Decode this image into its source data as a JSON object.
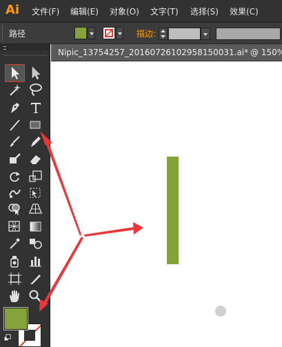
{
  "app": {
    "logo_text": "Ai"
  },
  "menu": {
    "items": [
      {
        "label": "文件(F)"
      },
      {
        "label": "编辑(E)"
      },
      {
        "label": "对象(O)"
      },
      {
        "label": "文字(T)"
      },
      {
        "label": "选择(S)"
      },
      {
        "label": "效果(C)"
      }
    ]
  },
  "control_bar": {
    "selection_type": "路径",
    "fill_color": "#86a23b",
    "stroke_color": "none",
    "stroke_label": "描边:",
    "stroke_weight": ""
  },
  "document_tab": {
    "title": "Nipic_13754257_20160726102958150031.ai*",
    "zoom": "@  150%  ("
  },
  "tools": [
    {
      "name": "selection-tool",
      "selected": true
    },
    {
      "name": "direct-selection-tool"
    },
    {
      "name": "magic-wand-tool"
    },
    {
      "name": "lasso-tool"
    },
    {
      "name": "pen-tool"
    },
    {
      "name": "type-tool"
    },
    {
      "name": "line-segment-tool"
    },
    {
      "name": "rectangle-tool"
    },
    {
      "name": "paintbrush-tool"
    },
    {
      "name": "pencil-tool"
    },
    {
      "name": "blob-brush-tool"
    },
    {
      "name": "eraser-tool"
    },
    {
      "name": "rotate-tool"
    },
    {
      "name": "scale-tool"
    },
    {
      "name": "warp-tool"
    },
    {
      "name": "free-transform-tool"
    },
    {
      "name": "shape-builder-tool"
    },
    {
      "name": "perspective-grid-tool"
    },
    {
      "name": "mesh-tool"
    },
    {
      "name": "gradient-tool"
    },
    {
      "name": "eyedropper-tool"
    },
    {
      "name": "blend-tool"
    },
    {
      "name": "symbol-sprayer-tool"
    },
    {
      "name": "column-graph-tool"
    },
    {
      "name": "artboard-tool"
    },
    {
      "name": "slice-tool"
    },
    {
      "name": "hand-tool"
    },
    {
      "name": "zoom-tool"
    }
  ],
  "swatches": {
    "fill": "#86a23b",
    "stroke": "none"
  },
  "canvas": {
    "shape_fill": "#84a23a"
  },
  "annotation": {
    "arrow_color": "#e8383a"
  }
}
